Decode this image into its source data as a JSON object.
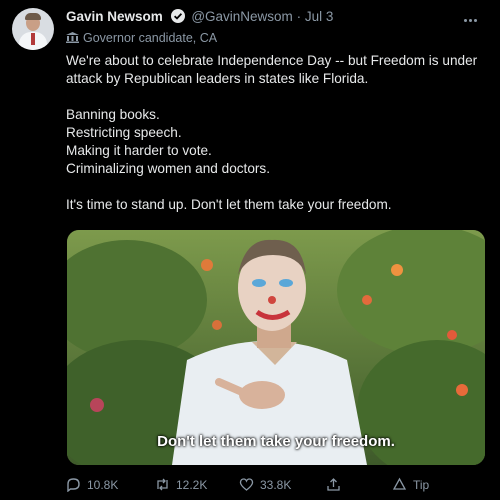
{
  "author": {
    "name": "Gavin Newsom",
    "handle": "@GavinNewsom",
    "separator": "·",
    "date": "Jul 3",
    "label": "Governor candidate, CA"
  },
  "tweet": {
    "paragraph1": "We're about to celebrate Independence Day -- but Freedom is under attack by Republican leaders in states like Florida.",
    "list": [
      "Banning books.",
      "Restricting speech.",
      "Making it harder to vote.",
      "Criminalizing women and doctors."
    ],
    "paragraph3": "It's time to stand up. Don't let them take your freedom."
  },
  "media": {
    "caption": "Don't let them take your freedom."
  },
  "actions": {
    "replies": "10.8K",
    "retweets": "12.2K",
    "likes": "33.8K",
    "tip": "Tip"
  },
  "colors": {
    "background": "#000000",
    "text": "#e7e9ea",
    "secondary": "#8b98a5"
  }
}
